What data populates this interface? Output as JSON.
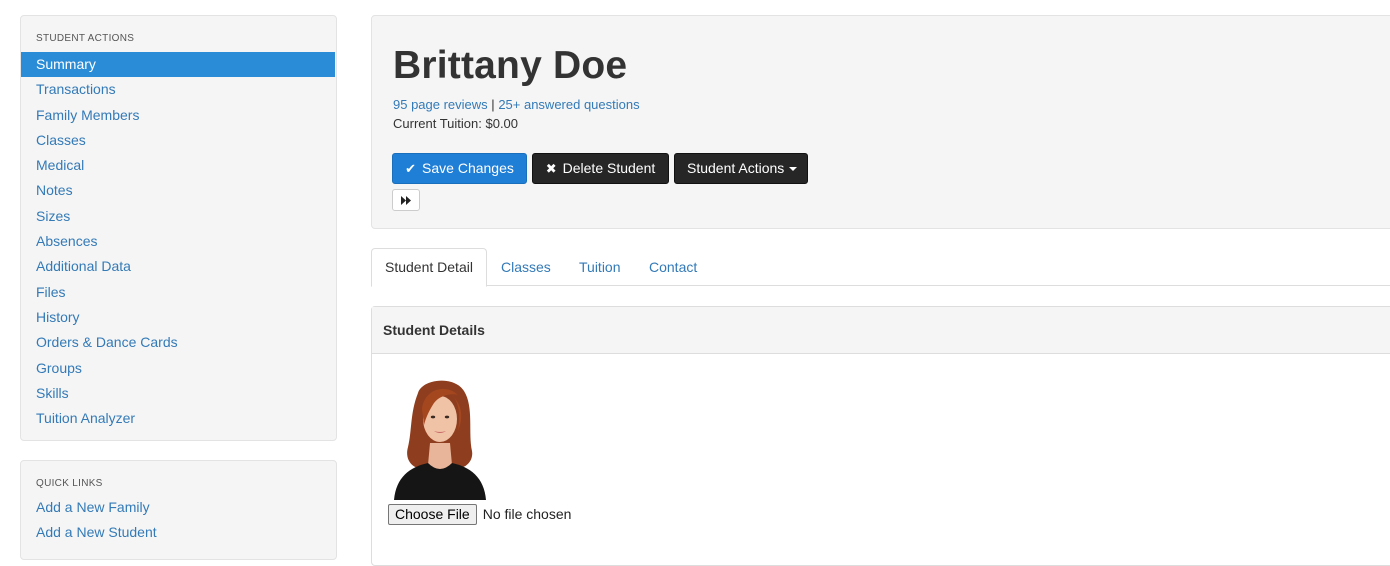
{
  "sidebar": {
    "actions_heading": "STUDENT ACTIONS",
    "items": [
      {
        "label": "Summary"
      },
      {
        "label": "Transactions"
      },
      {
        "label": "Family Members"
      },
      {
        "label": "Classes"
      },
      {
        "label": "Medical"
      },
      {
        "label": "Notes"
      },
      {
        "label": "Sizes"
      },
      {
        "label": "Absences"
      },
      {
        "label": "Additional Data"
      },
      {
        "label": "Files"
      },
      {
        "label": "History"
      },
      {
        "label": "Orders & Dance Cards"
      },
      {
        "label": "Groups"
      },
      {
        "label": "Skills"
      },
      {
        "label": "Tuition Analyzer"
      }
    ],
    "links_heading": "QUICK LINKS",
    "quick_links": [
      {
        "label": "Add a New Family"
      },
      {
        "label": "Add a New Student"
      }
    ]
  },
  "header": {
    "name": "Brittany Doe",
    "reviews_link": "95 page reviews",
    "separator": "|",
    "questions_link": "25+ answered questions",
    "tuition": "Current Tuition: $0.00",
    "save_label": "Save Changes",
    "delete_label": "Delete Student",
    "actions_label": "Student Actions"
  },
  "tabs": [
    {
      "label": "Student Detail"
    },
    {
      "label": "Classes"
    },
    {
      "label": "Tuition"
    },
    {
      "label": "Contact"
    }
  ],
  "details": {
    "heading": "Student Details",
    "choose_file": "Choose File",
    "no_file": "No file chosen"
  },
  "colors": {
    "primary": "#1f7ed6",
    "active_sidebar": "#2a8bd6",
    "link": "#337ab7",
    "dark_button": "#262626"
  }
}
